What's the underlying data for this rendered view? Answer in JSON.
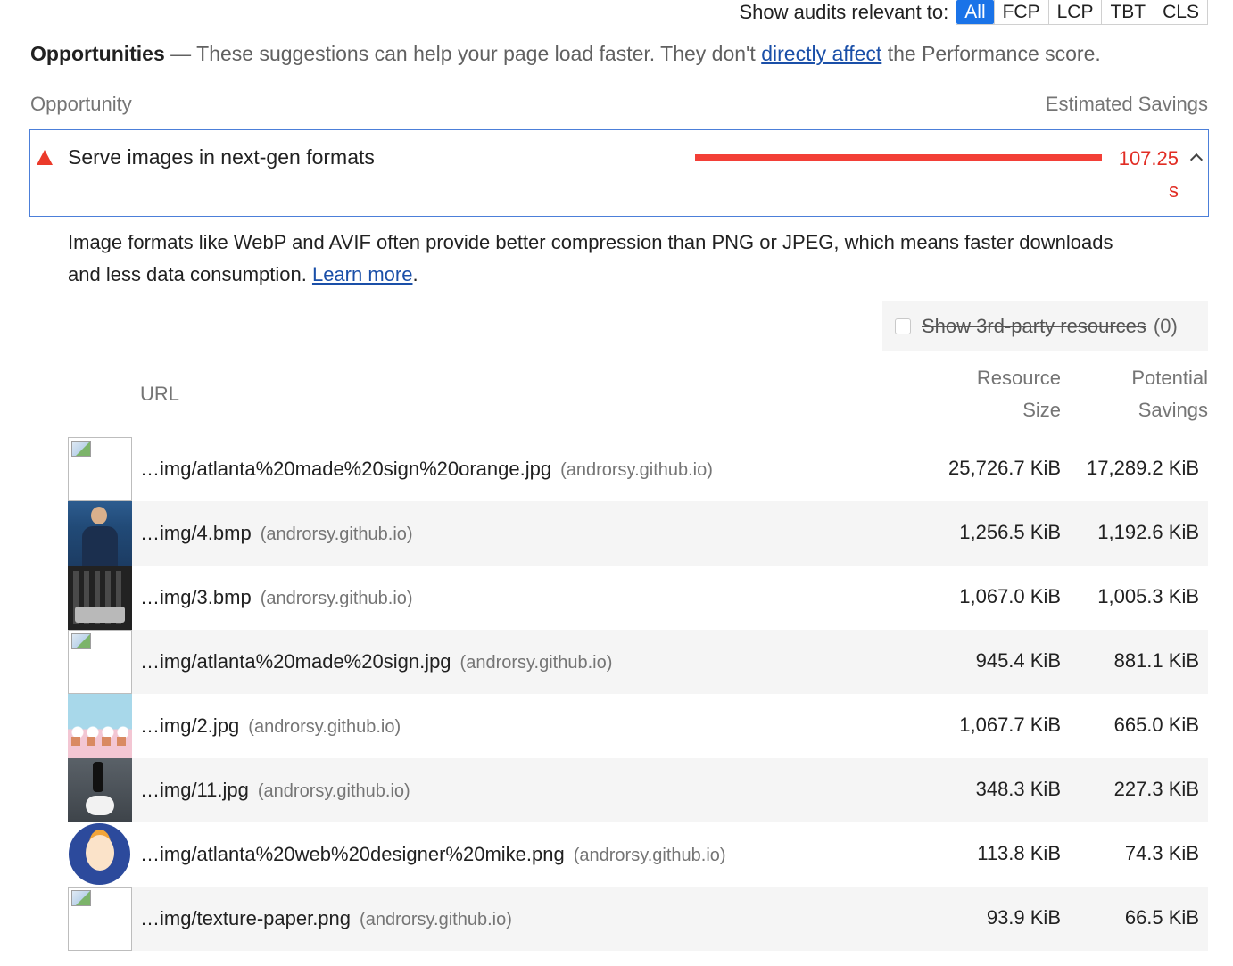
{
  "filters": {
    "label": "Show audits relevant to:",
    "buttons": [
      "All",
      "FCP",
      "LCP",
      "TBT",
      "CLS"
    ],
    "active": "All"
  },
  "opportunities": {
    "title": "Opportunities",
    "dash": " — ",
    "text_before_link": "These suggestions can help your page load faster. They don't ",
    "link": "directly affect",
    "text_after_link": " the Performance score."
  },
  "columns": {
    "opportunity": "Opportunity",
    "estimated_savings": "Estimated Savings"
  },
  "audit": {
    "title": "Serve images in next-gen formats",
    "savings": "107.25 s",
    "savings_fraction": 1.0,
    "description": "Image formats like WebP and AVIF often provide better compression than PNG or JPEG, which means faster downloads and less data consumption. ",
    "learn_more": "Learn more",
    "period": "."
  },
  "third_party": {
    "label": "Show 3rd-party resources",
    "count": "(0)"
  },
  "table": {
    "headers": {
      "url": "URL",
      "resource_size": "Resource Size",
      "potential_savings": "Potential Savings"
    },
    "rows": [
      {
        "url": "…img/atlanta%20made%20sign%20orange.jpg",
        "origin": "(androrsy.github.io)",
        "size": "25,726.7 KiB",
        "savings": "17,289.2 KiB",
        "thumb": "broken-image-icon"
      },
      {
        "url": "…img/4.bmp",
        "origin": "(androrsy.github.io)",
        "size": "1,256.5 KiB",
        "savings": "1,192.6 KiB",
        "thumb": "man"
      },
      {
        "url": "…img/3.bmp",
        "origin": "(androrsy.github.io)",
        "size": "1,067.0 KiB",
        "savings": "1,005.3 KiB",
        "thumb": "desk"
      },
      {
        "url": "…img/atlanta%20made%20sign.jpg",
        "origin": "(androrsy.github.io)",
        "size": "945.4 KiB",
        "savings": "881.1 KiB",
        "thumb": "broken-image-icon"
      },
      {
        "url": "…img/2.jpg",
        "origin": "(androrsy.github.io)",
        "size": "1,067.7 KiB",
        "savings": "665.0 KiB",
        "thumb": "cup"
      },
      {
        "url": "…img/11.jpg",
        "origin": "(androrsy.github.io)",
        "size": "348.3 KiB",
        "savings": "227.3 KiB",
        "thumb": "dog"
      },
      {
        "url": "…img/atlanta%20web%20designer%20mike.png",
        "origin": "(androrsy.github.io)",
        "size": "113.8 KiB",
        "savings": "74.3 KiB",
        "thumb": "avatar"
      },
      {
        "url": "…img/texture-paper.png",
        "origin": "(androrsy.github.io)",
        "size": "93.9 KiB",
        "savings": "66.5 KiB",
        "thumb": "broken-image-icon"
      }
    ]
  },
  "colors": {
    "accent": "#1a73e8",
    "fail": "#eb3a2a",
    "link": "#1a4fa8"
  }
}
